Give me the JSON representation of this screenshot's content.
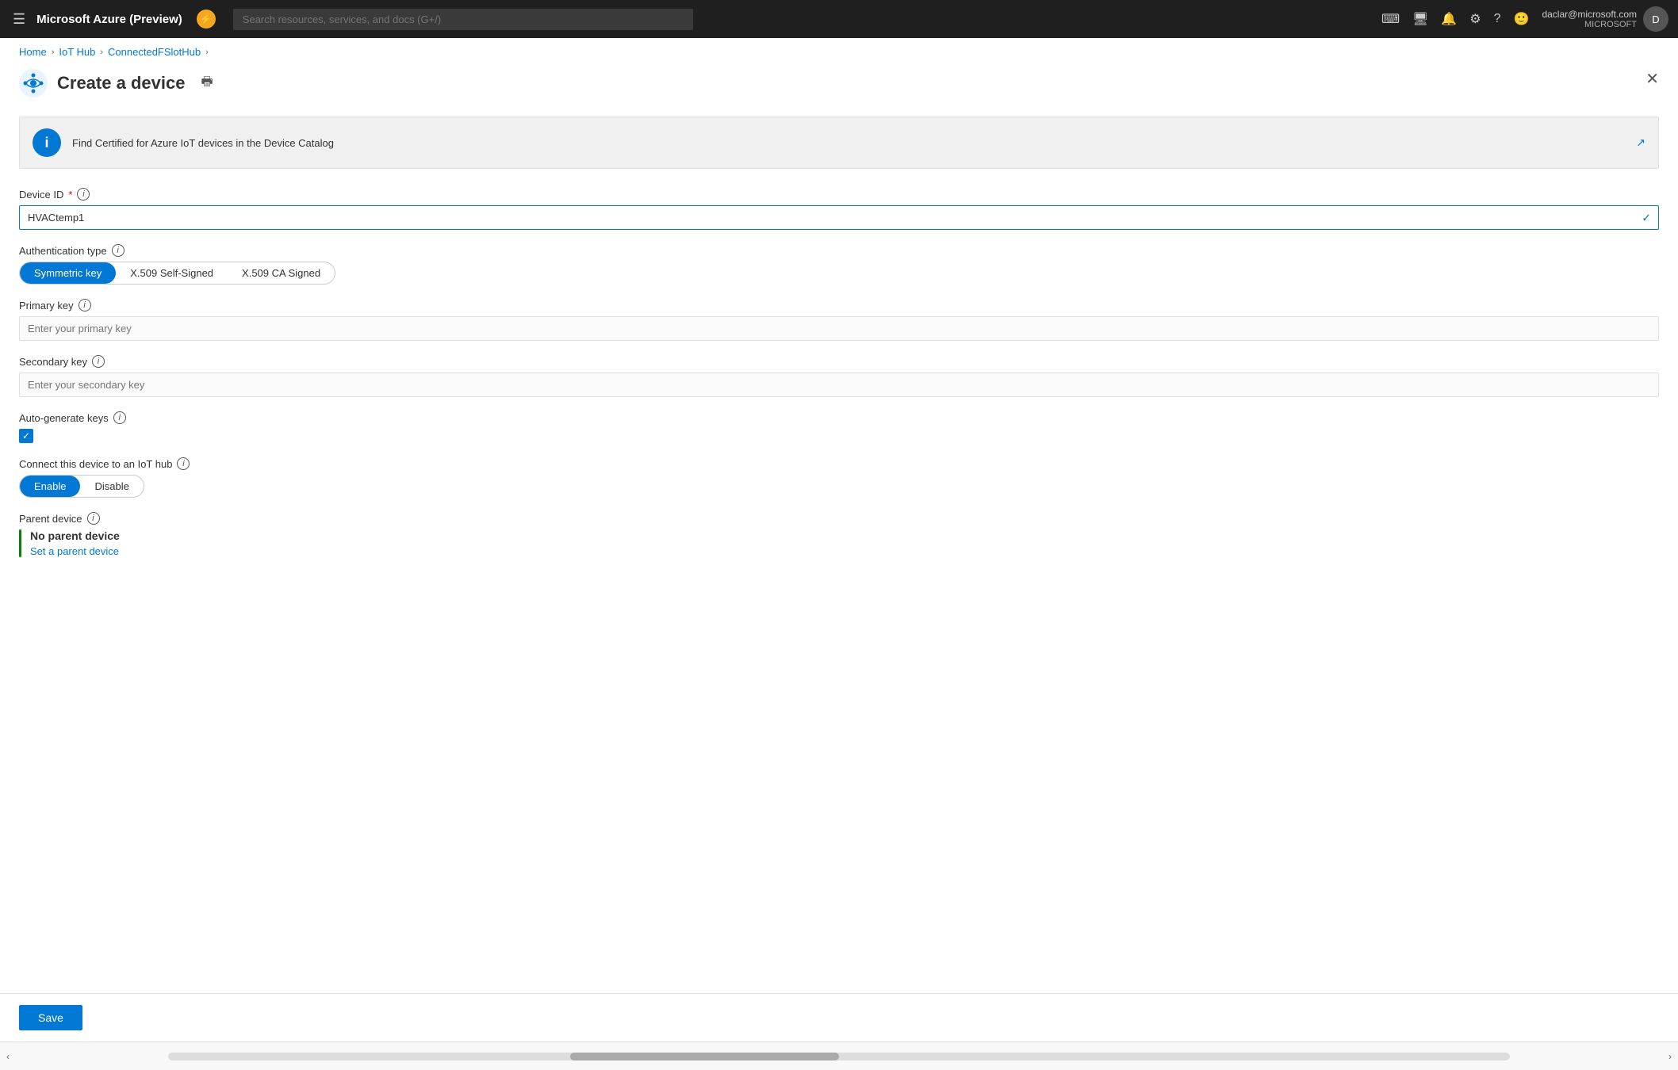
{
  "topbar": {
    "title": "Microsoft Azure (Preview)",
    "badge": "⚡",
    "search_placeholder": "Search resources, services, and docs (G+/)",
    "user_name": "daclar@microsoft.com",
    "user_org": "MICROSOFT"
  },
  "breadcrumb": {
    "home": "Home",
    "iot_hub": "IoT Hub",
    "hub_name": "ConnectedFSlotHub"
  },
  "page": {
    "title": "Create a device"
  },
  "info_banner": {
    "text": "Find Certified for Azure IoT devices in the Device Catalog"
  },
  "form": {
    "device_id_label": "Device ID",
    "device_id_value": "HVACtemp1",
    "auth_type_label": "Authentication type",
    "auth_options": [
      "Symmetric key",
      "X.509 Self-Signed",
      "X.509 CA Signed"
    ],
    "auth_active": "Symmetric key",
    "primary_key_label": "Primary key",
    "primary_key_placeholder": "Enter your primary key",
    "secondary_key_label": "Secondary key",
    "secondary_key_placeholder": "Enter your secondary key",
    "auto_generate_label": "Auto-generate keys",
    "connect_label": "Connect this device to an IoT hub",
    "connect_options": [
      "Enable",
      "Disable"
    ],
    "connect_active": "Enable",
    "parent_device_label": "Parent device",
    "parent_device_value": "No parent device",
    "parent_device_link": "Set a parent device"
  },
  "footer": {
    "save_label": "Save"
  },
  "icons": {
    "hamburger": "☰",
    "print": "🖨",
    "close": "✕",
    "info": "i",
    "check": "✓",
    "checkbox_check": "✓",
    "external_link": "↗",
    "chevron_right": "›",
    "scroll_left": "‹",
    "scroll_right": "›"
  }
}
